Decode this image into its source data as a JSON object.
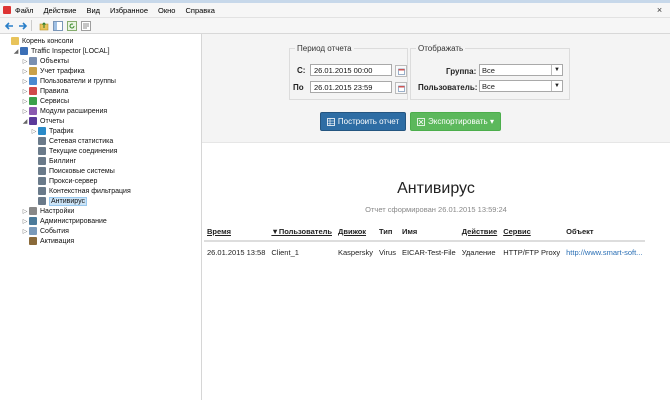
{
  "menu": [
    "Файл",
    "Действие",
    "Вид",
    "Избранное",
    "Окно",
    "Справка"
  ],
  "window": {
    "close": "×"
  },
  "toolbar": {
    "icons": [
      "back-arrow-icon",
      "forward-arrow-icon",
      "folder-up-icon",
      "console-tree-icon",
      "refresh-icon",
      "properties-icon"
    ]
  },
  "tree": [
    {
      "label": "Корень консоли",
      "icon": "folder-icon",
      "indent": 0
    },
    {
      "label": "Traffic Inspector [LOCAL]",
      "icon": "traffic-inspector-icon",
      "indent": 1,
      "exp": "◢"
    },
    {
      "label": "Объекты",
      "icon": "objects-icon",
      "indent": 2,
      "exp": "▷"
    },
    {
      "label": "Учет трафика",
      "icon": "traffic-accounting-icon",
      "indent": 2,
      "exp": "▷"
    },
    {
      "label": "Пользователи и группы",
      "icon": "users-icon",
      "indent": 2,
      "exp": "▷"
    },
    {
      "label": "Правила",
      "icon": "rules-icon",
      "indent": 2,
      "exp": "▷"
    },
    {
      "label": "Сервисы",
      "icon": "services-icon",
      "indent": 2,
      "exp": "▷"
    },
    {
      "label": "Модули расширения",
      "icon": "modules-icon",
      "indent": 2,
      "exp": "▷"
    },
    {
      "label": "Отчеты",
      "icon": "reports-icon",
      "indent": 2,
      "exp": "◢"
    },
    {
      "label": "Трафик",
      "icon": "traffic-icon",
      "indent": 3,
      "exp": "▷"
    },
    {
      "label": "Сетевая статистика",
      "icon": "report-item-icon",
      "indent": 3
    },
    {
      "label": "Текущие соединения",
      "icon": "report-item-icon",
      "indent": 3
    },
    {
      "label": "Биллинг",
      "icon": "report-item-icon",
      "indent": 3
    },
    {
      "label": "Поисковые системы",
      "icon": "report-item-icon",
      "indent": 3
    },
    {
      "label": "Прокси-сервер",
      "icon": "report-item-icon",
      "indent": 3
    },
    {
      "label": "Контекстная фильтрация",
      "icon": "report-item-icon",
      "indent": 3
    },
    {
      "label": "Антивирус",
      "icon": "report-item-icon",
      "indent": 3,
      "selected": true
    },
    {
      "label": "Настройки",
      "icon": "settings-icon",
      "indent": 2,
      "exp": "▷"
    },
    {
      "label": "Администрирование",
      "icon": "admin-icon",
      "indent": 2,
      "exp": "▷"
    },
    {
      "label": "События",
      "icon": "events-icon",
      "indent": 2,
      "exp": "▷"
    },
    {
      "label": "Активация",
      "icon": "key-icon",
      "indent": 2
    }
  ],
  "period": {
    "title": "Период отчета",
    "from_label": "С:",
    "from_value": "26.01.2015 00:00",
    "to_label": "По",
    "to_value": "26.01.2015 23:59"
  },
  "display": {
    "title": "Отображать",
    "group_label": "Группа:",
    "group_value": "Все",
    "user_label": "Пользователь:",
    "user_value": "Все"
  },
  "buttons": {
    "build": "Построить отчет",
    "export": "Экспортировать ▾"
  },
  "report": {
    "title": "Антивирус",
    "subtitle": "Отчет сформирован 26.01.2015 13:59:24",
    "columns": [
      "Время",
      "▼Пользователь",
      "Движок",
      "Тип",
      "Имя",
      "Действие",
      "Сервис",
      "Объект"
    ],
    "rows": [
      [
        "26.01.2015 13:58",
        "Client_1",
        "Kaspersky",
        "Virus",
        "EICAR-Test-File",
        "Удаление",
        "HTTP/FTP Proxy",
        "http://www.smart-soft..."
      ]
    ]
  },
  "colors": {
    "primary": "#2e6da4",
    "success": "#5cb85c",
    "link": "#2a6fb5",
    "selection": "#cce4f7"
  }
}
